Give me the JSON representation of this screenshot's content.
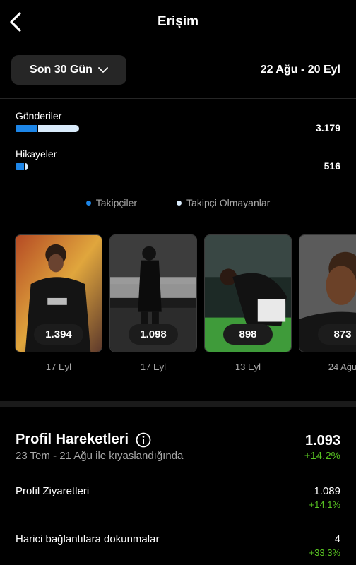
{
  "header": {
    "title": "Erişim"
  },
  "filter": {
    "range_label": "Son 30 Gün",
    "date_range": "22 Ağu - 20 Eyl"
  },
  "metrics": [
    {
      "label": "Gönderiler",
      "value": "3.179",
      "followers_share": 0.34
    },
    {
      "label": "Hikayeler",
      "value": "516",
      "followers_share": 0.8
    }
  ],
  "legend": {
    "followers": "Takipçiler",
    "non_followers": "Takipçi Olmayanlar"
  },
  "colors": {
    "followers": "#1d86e8",
    "non_followers": "#d9ebfb",
    "positive": "#58c322"
  },
  "top_content": [
    {
      "value": "1.394",
      "date": "17 Eyl"
    },
    {
      "value": "1.098",
      "date": "17 Eyl"
    },
    {
      "value": "898",
      "date": "13 Eyl"
    },
    {
      "value": "873",
      "date": "24 Ağu"
    }
  ],
  "profile_activity": {
    "title": "Profil Hareketleri",
    "subtitle": "23 Tem - 21 Ağu ile kıyaslandığında",
    "total": "1.093",
    "total_change": "+14,2%",
    "rows": [
      {
        "label": "Profil Ziyaretleri",
        "value": "1.089",
        "change": "+14,1%"
      },
      {
        "label": "Harici bağlantılara dokunmalar",
        "value": "4",
        "change": "+33,3%"
      }
    ]
  }
}
